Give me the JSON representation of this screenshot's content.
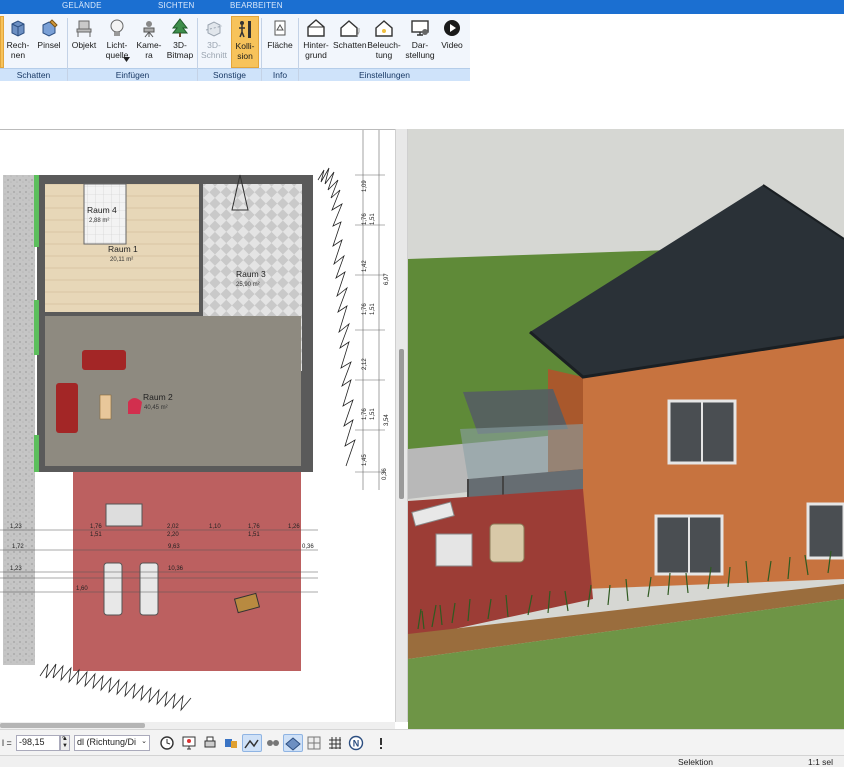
{
  "ribbon": {
    "tabs": [
      "GELÄNDE",
      "SICHTEN",
      "BEARBEITEN"
    ],
    "buttons": {
      "rechnen": "Rech-\nnen",
      "pinsel": "Pinsel",
      "objekt": "Objekt",
      "lichtquelle": "Licht-\nquelle",
      "kamera": "Kame-\nra",
      "bitmap": "3D-\nBitmap",
      "schnitt": "3D-\nSchnitt",
      "kollision": "Kolli-\nsion",
      "flaeche": "Fläche",
      "hintergrund": "Hinter-\ngrund",
      "schatten": "Schatten",
      "beleuchtung": "Beleuch-\ntung",
      "darstellung": "Dar-\nstellung",
      "video": "Video"
    },
    "groups": {
      "schatten": "Schatten",
      "einfuegen": "Einfügen",
      "sonstige": "Sonstige",
      "info": "Info",
      "einstellungen": "Einstellungen"
    }
  },
  "plan": {
    "rooms": [
      {
        "name": "Raum 4",
        "area": "2,88 m²"
      },
      {
        "name": "Raum 1",
        "area": "20,11 m²"
      },
      {
        "name": "Raum 3",
        "area": "25,90 m²"
      },
      {
        "name": "Raum 2",
        "area": "40,45 m²"
      }
    ],
    "dims_vertical": [
      "1,09",
      "1,76",
      "1,51",
      "1,42",
      "6,97",
      "1,76",
      "1,51",
      "2,12",
      "1,76",
      "3,54",
      "1,51",
      "1,45",
      "0,36"
    ],
    "dims_row1_top": [
      "1,23",
      "1,76",
      "2,02",
      "1,10",
      "1,76",
      "1,26"
    ],
    "dims_row1_bottom": [
      "1,51",
      "2,20",
      "1,51"
    ],
    "dims_row2": [
      "1,72",
      "9,63"
    ],
    "dims_row3": [
      "1,23",
      "10,36"
    ],
    "dims_misc": [
      "1,60",
      "0,36"
    ]
  },
  "bottombar": {
    "angle_label": "l =",
    "angle_value": "-98,15",
    "angle_unit": "°",
    "mode_value": "dl (Richtung/Di"
  },
  "status": {
    "mode": "Selektion",
    "scale": "1:1 sel"
  },
  "colors": {
    "ribbon_blue": "#1b6fd1",
    "active_button": "#f7c35b",
    "terrace_red": "#b04a4a",
    "facade": "#c7713f",
    "roof": "#2b3238",
    "lawn": "#6a8f3c"
  },
  "icons": [
    "calculator-icon",
    "brush-icon",
    "chair-icon",
    "bulb-icon",
    "camera-icon",
    "tree-icon",
    "section-icon",
    "collision-icon",
    "area-icon",
    "background-icon",
    "shadow-icon",
    "lighting-icon",
    "display-icon",
    "video-icon"
  ]
}
